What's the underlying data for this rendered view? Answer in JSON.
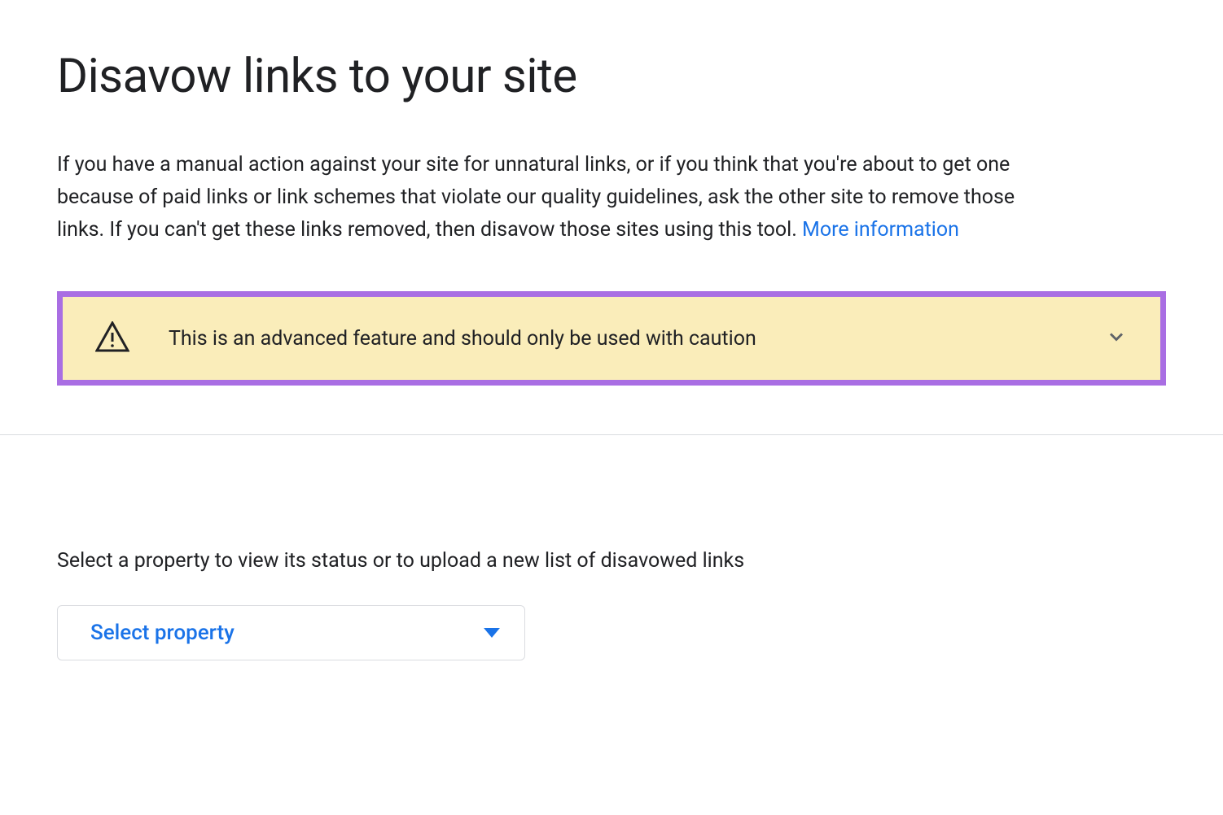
{
  "page": {
    "title": "Disavow links to your site",
    "description_text": "If you have a manual action against your site for unnatural links, or if you think that you're about to get one because of paid links or link schemes that violate our quality guidelines, ask the other site to remove those links. If you can't get these links removed, then disavow those sites using this tool. ",
    "more_info_link": "More information"
  },
  "warning": {
    "text": "This is an advanced feature and should only be used with caution"
  },
  "property_section": {
    "label": "Select a property to view its status or to upload a new list of disavowed links",
    "dropdown_label": "Select property"
  }
}
